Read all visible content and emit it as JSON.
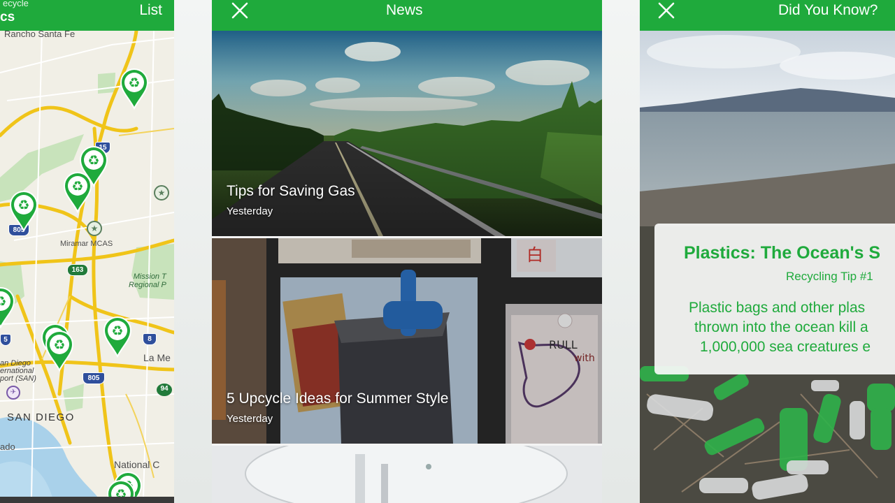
{
  "map_screen": {
    "header": {
      "partial_subtitle": "ecycle",
      "partial_title": "cs",
      "list_label": "List"
    },
    "labels": {
      "rancho": "Rancho Santa Fe",
      "miramar": "Miramar MCAS",
      "mission_1": "Mission T",
      "mission_2": "Regional P",
      "la_mesa": "La Me",
      "sandiego": "SAN DIEGO",
      "airport_1": "an Diego",
      "airport_2": "ernational",
      "airport_3": "port (SAN)",
      "national_city": "National C",
      "coronado": "ado"
    },
    "shields": {
      "i5_a": "5",
      "i805": "805",
      "sr163": "163",
      "i15": "15",
      "i5_b": "5",
      "i8": "8",
      "i805_b": "805",
      "sr94": "94"
    }
  },
  "news_screen": {
    "title": "News",
    "articles": [
      {
        "headline": "Tips for Saving Gas",
        "time": "Yesterday"
      },
      {
        "headline": "5 Upcycle Ideas for Summer Style",
        "time": "Yesterday"
      }
    ]
  },
  "dyk_screen": {
    "title": "Did You Know?",
    "tip": {
      "title": "Plastics: The Ocean's S",
      "subtitle": "Recycling Tip #1",
      "body_lines": [
        "Plastic bags and other plas",
        "thrown into the ocean kill a",
        "1,000,000 sea creatures e"
      ]
    }
  },
  "colors": {
    "brand_green": "#1faa3c"
  }
}
